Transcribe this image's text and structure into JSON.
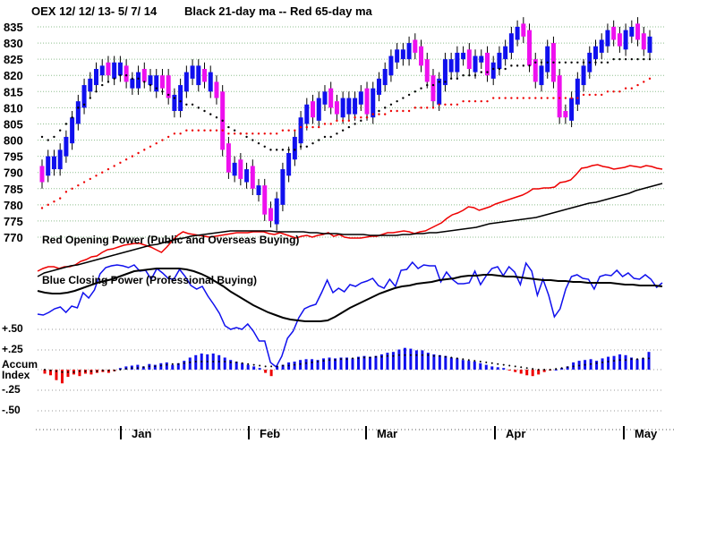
{
  "chart_data": {
    "type": "candlestick",
    "title": "OEX   12/ 12/ 13- 5/ 7/ 14",
    "ma_labels": {
      "black": "Black 21-day ma --",
      "red": "Red 65-day ma"
    },
    "price_axis": {
      "ticks": [
        835,
        830,
        825,
        820,
        815,
        810,
        805,
        800,
        795,
        790,
        785,
        780,
        775,
        770
      ],
      "ylim": [
        770,
        837
      ]
    },
    "months": [
      "Jan",
      "Feb",
      "Mar",
      "Apr",
      "May"
    ],
    "ohlc_close": [
      790,
      794,
      792,
      796,
      800,
      806,
      811,
      816,
      818,
      821,
      822,
      820,
      823,
      821,
      818,
      817,
      820,
      818,
      819,
      816,
      818,
      813,
      810,
      816,
      820,
      822,
      818,
      820,
      816,
      813,
      797,
      790,
      792,
      788,
      790,
      785,
      784,
      777,
      775,
      781,
      790,
      795,
      800,
      806,
      810,
      807,
      812,
      814,
      810,
      808,
      812,
      809,
      812,
      814,
      808,
      815,
      818,
      821,
      825,
      827,
      826,
      829,
      827,
      823,
      818,
      812,
      818,
      824,
      822,
      826,
      826,
      822,
      825,
      825,
      820,
      823,
      826,
      828,
      832,
      834,
      832,
      823,
      818,
      822,
      828,
      818,
      807,
      807,
      812,
      818,
      822,
      826,
      828,
      830,
      833,
      831,
      829,
      833,
      834,
      831,
      828,
      831
    ],
    "bear_days": [
      0,
      11,
      14,
      17,
      20,
      21,
      27,
      29,
      30,
      31,
      33,
      35,
      37,
      38,
      45,
      48,
      49,
      54,
      62,
      63,
      64,
      65,
      71,
      74,
      80,
      81,
      82,
      85,
      86,
      87,
      95,
      96,
      99,
      100
    ],
    "ma21": [
      801,
      800,
      801,
      803,
      805,
      807,
      810,
      811,
      813,
      815,
      817,
      818,
      819,
      820,
      820,
      819,
      819,
      818,
      817,
      816,
      815,
      814,
      813,
      812,
      811,
      811,
      810,
      809,
      808,
      807,
      806,
      804,
      803,
      802,
      801,
      800,
      799,
      798,
      797,
      797,
      797,
      797,
      797,
      798,
      798,
      799,
      800,
      801,
      801,
      802,
      803,
      804,
      805,
      806,
      807,
      808,
      809,
      810,
      811,
      812,
      813,
      814,
      815,
      816,
      817,
      817,
      818,
      818,
      819,
      819,
      820,
      820,
      820,
      821,
      821,
      822,
      822,
      822,
      823,
      823,
      823,
      823,
      824,
      824,
      824,
      824,
      824,
      824,
      824,
      824,
      824,
      824,
      824,
      824,
      824,
      825,
      825,
      825,
      825,
      825,
      825,
      825
    ],
    "ma65": [
      779,
      780,
      781,
      782,
      784,
      785,
      786,
      787,
      788,
      789,
      790,
      791,
      792,
      793,
      794,
      795,
      796,
      797,
      798,
      799,
      800,
      801,
      802,
      802,
      803,
      803,
      803,
      803,
      803,
      803,
      803,
      802,
      802,
      802,
      802,
      802,
      802,
      802,
      802,
      802,
      803,
      803,
      803,
      804,
      804,
      804,
      804,
      805,
      805,
      806,
      806,
      806,
      807,
      807,
      807,
      808,
      808,
      808,
      809,
      809,
      809,
      809,
      810,
      810,
      810,
      810,
      811,
      811,
      811,
      811,
      812,
      812,
      812,
      812,
      812,
      813,
      813,
      813,
      813,
      813,
      813,
      813,
      813,
      813,
      813,
      813,
      813,
      813,
      813,
      813,
      814,
      814,
      814,
      814,
      815,
      815,
      815,
      816,
      816,
      817,
      818,
      819
    ],
    "power_labels": {
      "red": "Red Opening Power (Public and Overseas Buying)",
      "blue": "Blue Closing Power (Professional Buying)"
    },
    "red_power": [
      303,
      300,
      298,
      298,
      300,
      298,
      298,
      296,
      292,
      290,
      287,
      286,
      282,
      279,
      278,
      276,
      274,
      273,
      272,
      272,
      274,
      276,
      279,
      282,
      276,
      269,
      263,
      259,
      261,
      262,
      263,
      264,
      265,
      264,
      263,
      262,
      261,
      260,
      260,
      260,
      259,
      259,
      259,
      261,
      262,
      260,
      262,
      264,
      266,
      264,
      263,
      265,
      263,
      262,
      260,
      264,
      262,
      265,
      266,
      266,
      266,
      265,
      264,
      264,
      262,
      260,
      260,
      259,
      258,
      259,
      261,
      259,
      258,
      255,
      252,
      249,
      244,
      240,
      238,
      235,
      231,
      232,
      235,
      233,
      231,
      228,
      226,
      224,
      222,
      220,
      218,
      215,
      211,
      211,
      210,
      210,
      209,
      204,
      203,
      201,
      195,
      188,
      187,
      185,
      184,
      186,
      187,
      189,
      188,
      187,
      185,
      186,
      187,
      185,
      186,
      188,
      189
    ],
    "red_power_ma": [
      309,
      305,
      303,
      301,
      299,
      297,
      296,
      294,
      292,
      290,
      288,
      286,
      284,
      282,
      280,
      278,
      276,
      274,
      273,
      271,
      269,
      267,
      266,
      264,
      263,
      262,
      261,
      260,
      259,
      258,
      258,
      258,
      258,
      258,
      258,
      258,
      259,
      259,
      259,
      259,
      259,
      260,
      260,
      261,
      261,
      261,
      262,
      262,
      262,
      262,
      263,
      263,
      263,
      263,
      263,
      262,
      262,
      261,
      261,
      260,
      260,
      259,
      258,
      257,
      256,
      255,
      254,
      252,
      250,
      249,
      248,
      247,
      246,
      245,
      244,
      243,
      241,
      239,
      237,
      235,
      233,
      231,
      229,
      227,
      226,
      224,
      222,
      220,
      218,
      216,
      213,
      211,
      209,
      207,
      205
    ],
    "blue_power": [
      351,
      352,
      349,
      345,
      343,
      349,
      342,
      344,
      327,
      333,
      324,
      306,
      299,
      297,
      296,
      297,
      299,
      296,
      303,
      302,
      312,
      300,
      305,
      311,
      312,
      301,
      309,
      319,
      323,
      320,
      331,
      340,
      350,
      364,
      368,
      366,
      368,
      362,
      370,
      381,
      381,
      405,
      410,
      398,
      378,
      370,
      355,
      345,
      342,
      340,
      327,
      313,
      327,
      322,
      326,
      318,
      320,
      316,
      314,
      311,
      319,
      322,
      312,
      320,
      302,
      301,
      293,
      300,
      296,
      297,
      297,
      315,
      304,
      312,
      317,
      317,
      316,
      303,
      318,
      308,
      300,
      298,
      308,
      298,
      304,
      318,
      294,
      303,
      330,
      312,
      330,
      354,
      345,
      323,
      309,
      307,
      311,
      312,
      323,
      309,
      307,
      308,
      302,
      309,
      305,
      311,
      312,
      307,
      312,
      321,
      316
    ],
    "blue_power_ma": [
      325,
      327,
      328,
      328,
      327,
      325,
      322,
      319,
      316,
      314,
      312,
      309,
      306,
      303,
      302,
      301,
      300,
      300,
      300,
      300,
      301,
      303,
      306,
      310,
      315,
      320,
      326,
      331,
      336,
      341,
      345,
      349,
      352,
      355,
      357,
      358,
      359,
      359,
      359,
      358,
      354,
      349,
      344,
      340,
      336,
      332,
      328,
      325,
      322,
      320,
      319,
      317,
      316,
      315,
      313,
      312,
      311,
      309,
      308,
      308,
      307,
      307,
      308,
      309,
      309,
      310,
      311,
      312,
      313,
      313,
      314,
      314,
      315,
      315,
      316,
      316,
      316,
      316,
      317,
      318,
      318,
      319,
      319,
      319,
      320
    ],
    "accum_axis": {
      "ticks": [
        "+.50",
        "+.25",
        "Accum Index",
        "-.25",
        "-.50"
      ],
      "ylim": [
        -0.5,
        0.5
      ]
    },
    "accum_index": [
      -0.05,
      -0.07,
      -0.13,
      -0.17,
      -0.09,
      -0.06,
      -0.08,
      -0.05,
      -0.06,
      -0.04,
      -0.03,
      -0.04,
      -0.02,
      0.02,
      0.04,
      0.05,
      0.06,
      0.04,
      0.07,
      0.06,
      0.08,
      0.09,
      0.06,
      0.08,
      0.11,
      0.15,
      0.18,
      0.2,
      0.19,
      0.2,
      0.18,
      0.15,
      0.12,
      0.1,
      0.08,
      0.06,
      0.04,
      0.02,
      -0.04,
      -0.08,
      0.04,
      0.06,
      0.09,
      0.1,
      0.12,
      0.13,
      0.13,
      0.12,
      0.14,
      0.15,
      0.14,
      0.15,
      0.15,
      0.14,
      0.16,
      0.17,
      0.16,
      0.17,
      0.19,
      0.21,
      0.22,
      0.25,
      0.27,
      0.26,
      0.24,
      0.24,
      0.21,
      0.19,
      0.18,
      0.17,
      0.15,
      0.14,
      0.12,
      0.11,
      0.1,
      0.08,
      0.06,
      0.04,
      0.03,
      0.02,
      -0.01,
      -0.03,
      -0.05,
      -0.07,
      -0.08,
      -0.06,
      -0.03,
      -0.01,
      0.0,
      0.02,
      0.04,
      0.09,
      0.11,
      0.12,
      0.13,
      0.11,
      0.14,
      0.16,
      0.17,
      0.19,
      0.18,
      0.15,
      0.13,
      0.14,
      0.22
    ],
    "accum_ma": [
      0.0,
      -0.01,
      -0.02,
      -0.03,
      -0.03,
      -0.03,
      -0.02,
      -0.02,
      -0.02,
      -0.02,
      -0.01,
      -0.01,
      -0.01,
      0.0,
      0.01,
      0.02,
      0.02,
      0.03,
      0.04,
      0.04,
      0.05,
      0.06,
      0.07,
      0.07,
      0.08,
      0.09,
      0.1,
      0.1,
      0.1,
      0.1,
      0.1,
      0.1,
      0.09,
      0.09,
      0.08,
      0.07,
      0.06,
      0.05,
      0.04,
      0.04,
      0.04,
      0.05,
      0.05,
      0.06,
      0.07,
      0.08,
      0.09,
      0.1,
      0.11,
      0.12,
      0.12,
      0.13,
      0.13,
      0.14,
      0.14,
      0.15,
      0.15,
      0.16,
      0.16,
      0.17,
      0.17,
      0.18,
      0.18,
      0.18,
      0.18,
      0.18,
      0.18,
      0.17,
      0.17,
      0.16,
      0.15,
      0.14,
      0.13,
      0.12,
      0.11,
      0.1,
      0.09,
      0.08,
      0.07,
      0.06,
      0.05,
      0.04,
      0.03,
      0.02,
      0.01,
      0.0,
      0.0,
      0.0,
      0.01,
      0.02,
      0.03,
      0.04,
      0.05,
      0.06,
      0.07,
      0.08,
      0.09,
      0.1,
      0.11,
      0.12,
      0.12,
      0.13,
      0.13,
      0.14,
      0.14
    ],
    "colors": {
      "bull_candle": "#1010ee",
      "bear_candle": "#ee10ee",
      "ma21": "#000000",
      "ma65": "#ee0000",
      "red_power": "#ee0000",
      "blue_power": "#1010ee",
      "accum_pos": "#1010ee",
      "accum_neg": "#ee0000",
      "grid": "#8fbf8f",
      "text": "#000000"
    },
    "grid": true
  }
}
